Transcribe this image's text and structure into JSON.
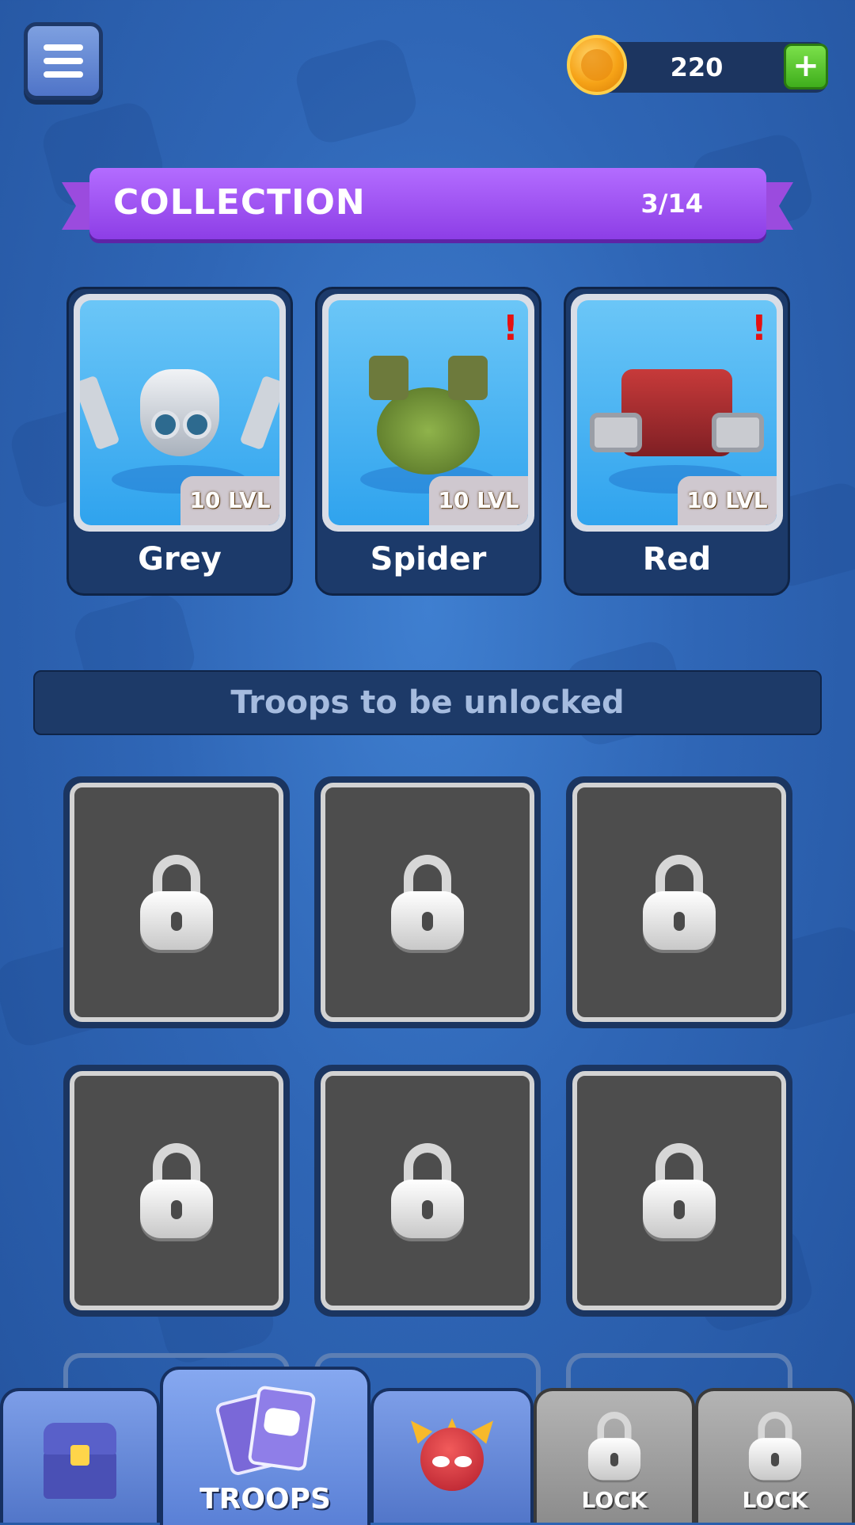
{
  "header": {
    "menu_icon": "hamburger-menu-icon",
    "coins": "220",
    "add_coins_icon": "plus-icon"
  },
  "collection": {
    "title": "Collection",
    "count": "3/14"
  },
  "troops": [
    {
      "name": "Grey",
      "level": "10 LVL",
      "alert": ""
    },
    {
      "name": "Spider",
      "level": "10 LVL",
      "alert": "!"
    },
    {
      "name": "Red",
      "level": "10 LVL",
      "alert": "!"
    }
  ],
  "unlock_section": {
    "title": "Troops to be unlocked"
  },
  "bottom_nav": {
    "tabs": [
      {
        "label": "",
        "icon": "chest-icon"
      },
      {
        "label": "TROOPS",
        "icon": "troop-cards-icon"
      },
      {
        "label": "",
        "icon": "battle-mask-icon"
      },
      {
        "label": "LOCK",
        "icon": "lock-icon"
      },
      {
        "label": "LOCK",
        "icon": "lock-icon"
      }
    ]
  },
  "colors": {
    "background": "#2f66b6",
    "banner": "#9b4bde",
    "card_dark": "#1c3a6a",
    "locked_slot": "#4d4d4d",
    "alert": "#e51111",
    "plus_green": "#3fae1c"
  }
}
